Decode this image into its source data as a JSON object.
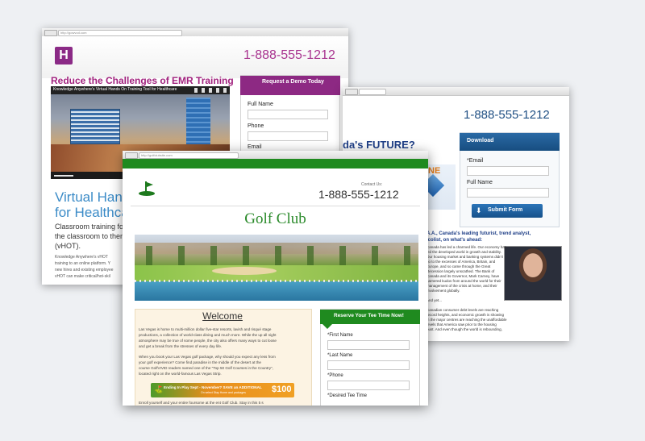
{
  "emr": {
    "url": "http://gowvod.com",
    "logo_letter": "H",
    "phone": "1-888-555-1212",
    "headline": "Reduce the Challenges of EMR Training",
    "video_title": "Knowledge Anywhere's Virtual Hands On Training Tool for Healthcare",
    "form_title": "Request a Demo Today",
    "full_name_label": "Full Name",
    "phone_label": "Phone",
    "email_label": "Email",
    "hero_line1": "Virtual Hand",
    "hero_line2": "for Healthca",
    "desc_1": "Classroom training for",
    "desc_2": "the classroom to them",
    "desc_3": "(vHOT).",
    "small_1": "Knowledge Anywhere's vHOT",
    "small_2": "training to an online platform. Y",
    "small_3": "new hires and existing employee",
    "small_4": "vHOT can make critical/hot-skil"
  },
  "future": {
    "url": "",
    "phone": "1-888-555-1212",
    "headline": "da's FUTURE?",
    "promo_letters": "NE",
    "form_title": "Download",
    "email_label": "*Email",
    "full_name_label": "Full Name",
    "submit_label": "Submit Form",
    "quote_head_1": "A.A., Canada's leading futurist, trend analyst,",
    "quote_head_2": "icolist, on what's ahead:",
    "body_1": "Canada has led a charmed life. Our economy has",
    "body_2": "led the developed world in growth and stability.",
    "body_3": "Our housing market and banking systems didn't",
    "body_4": "go to the excesses of America, Britain, and",
    "body_5": "Europe, and so came through the Great",
    "body_6": "Recession largely unscathed. The Bank of",
    "body_7": "Canada and its Governor, Mark Carney, have",
    "body_8": "garnered kudos from around the world for their",
    "body_9": "management of the crisis at home, and their",
    "body_10": "involvement globally.",
    "body_11": "And yet...",
    "body_12": "Canadian consumer debt levels are reaching",
    "body_13": "record heights, and economic growth is showing",
    "body_14": "in the major centres are reaching the unaffordable",
    "body_15": "levels that America saw prior to the housing",
    "body_16": "bust. And even though the world is rebounding,"
  },
  "golf": {
    "url": "http://golfclubsite.com",
    "contact_label": "Contact Us:",
    "phone": "1-888-555-1212",
    "title": "Golf Club",
    "welcome": "Welcome",
    "para_1a": "Las Vegas is home to multi-million dollar five-star resorts, lavish and risqué stage",
    "para_1b": "productions, a collection of world-class dining and much more. While the up all night",
    "para_1c": "atmosphere may be true of some people, the city also offers many ways to cut loose",
    "para_1d": "and get a break from the stresses of every day life.",
    "para_2a": "When you book your Las Vegas golf package, why should you expect any less from",
    "para_2b": "your golf experience? Come find paradise in the middle of the desert at the",
    "para_2c": "course GolfVIVID readers named one of the \"Top 50 Golf Courses in the Country\",",
    "para_2d": "located right on the world-famous Las Vegas Strip.",
    "banner_text": "Ending In Play Sept - November? SAVE an ADDITIONAL",
    "banner_sub": "On select Stay Home and packages",
    "banner_amount": "$100",
    "tail_text": "Enroll yourself and your entire foursome at the ent Golf Club. Stay in this 5 s",
    "form_title": "Reserve Your Tee Time Now!",
    "first_name_label": "*First Name",
    "last_name_label": "*Last Name",
    "phone_label": "*Phone",
    "tee_time_label": "*Desired Tee Time"
  }
}
